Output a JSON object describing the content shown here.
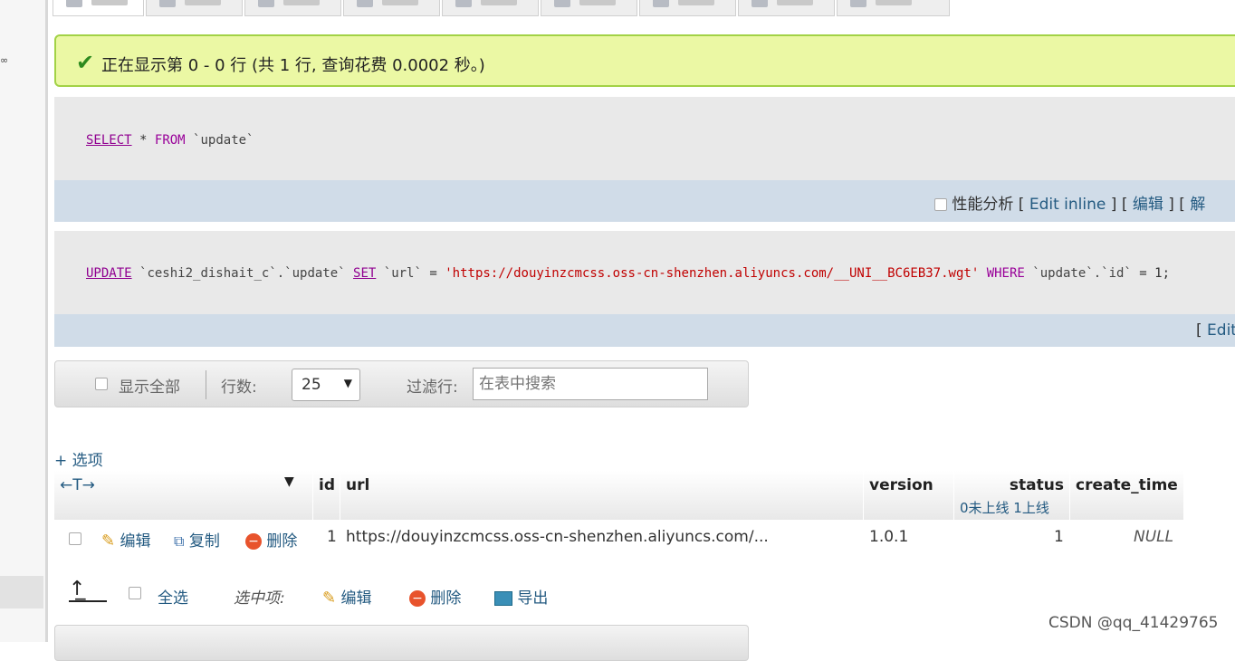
{
  "success": {
    "message": "正在显示第 0 - 0 行 (共 1 行, 查询花费 0.0002 秒。)",
    "icon": "check-icon"
  },
  "query1": {
    "kw_select": "SELECT",
    "star": "*",
    "kw_from": "FROM",
    "table": "`update`",
    "profile_label": "性能分析",
    "edit_inline": "Edit inline",
    "edit": "编辑",
    "explain_partial": "解"
  },
  "query2": {
    "kw_update": "UPDATE",
    "target": "`ceshi2_dishait_c`.`update`",
    "kw_set": "SET",
    "col": "`url`",
    "eq": "=",
    "value": "'https://douyinzcmcss.oss-cn-shenzhen.aliyuncs.com/__UNI__BC6EB37.wgt'",
    "kw_where": "WHERE",
    "where_col": "`update`.`id`",
    "where_rest": "= 1;",
    "edit_partial": "Edit"
  },
  "nav": {
    "show_all": "显示全部",
    "rows_label": "行数:",
    "rows_value": "25",
    "filter_label": "过滤行:",
    "filter_placeholder": "在表中搜索"
  },
  "options_link": "+ 选项",
  "table": {
    "arrows": "←T→",
    "columns": [
      "id",
      "url",
      "version",
      "status",
      "create_time"
    ],
    "status_sub": "0未上线 1上线",
    "row": {
      "edit": "编辑",
      "copy": "复制",
      "delete": "删除",
      "id": "1",
      "url": "https://douyinzcmcss.oss-cn-shenzhen.aliyuncs.com/...",
      "version": "1.0.1",
      "status": "1",
      "create_time": "NULL"
    }
  },
  "bulk": {
    "select_all": "全选",
    "with_selected": "选中项:",
    "edit": "编辑",
    "delete": "删除",
    "export": "导出"
  },
  "watermark": "CSDN @qq_41429765",
  "colors": {
    "success_bg": "#ebf8a4",
    "success_border": "#a2d246",
    "link": "#235a81",
    "sql_bar": "#d0dce8"
  }
}
